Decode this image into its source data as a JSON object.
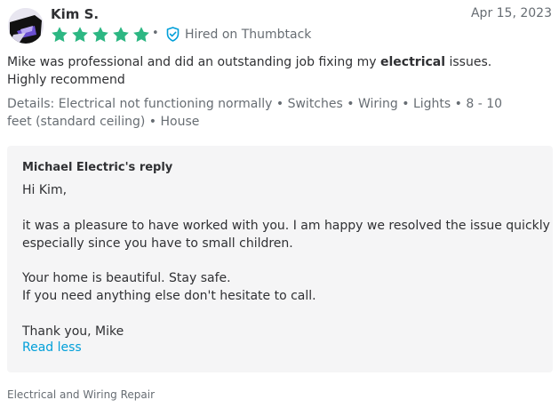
{
  "reviewer": {
    "name": "Kim S.",
    "date": "Apr 15, 2023",
    "rating": 5,
    "separator": "•"
  },
  "badge": {
    "label": "Hired on Thumbtack",
    "icon": "shield-check-icon"
  },
  "review": {
    "text_before": "Mike was professional and did an outstanding job fixing my ",
    "highlight": "electrical",
    "text_after": " issues. Highly recommend"
  },
  "details": {
    "label": "Details:",
    "items": [
      "Electrical not functioning normally",
      "Switches",
      "Wiring",
      "Lights",
      "8 - 10 feet (standard ceiling)",
      "House"
    ],
    "separator": "•"
  },
  "reply": {
    "title": "Michael Electric's reply",
    "lines": [
      "Hi Kim,",
      "it was a pleasure to have worked with you. I am happy we resolved the issue quickly",
      "especially since you have to small children.",
      "Your home is beautiful. Stay safe.",
      "If you need anything else don't hesitate to call.",
      "Thank you, Mike"
    ],
    "toggle_label": "Read less"
  },
  "category": "Electrical and Wiring Repair",
  "colors": {
    "star": "#2db783",
    "accent": "#009fd9",
    "muted": "#676d73",
    "text": "#2f3033",
    "reply_bg": "#f5f5f6"
  }
}
